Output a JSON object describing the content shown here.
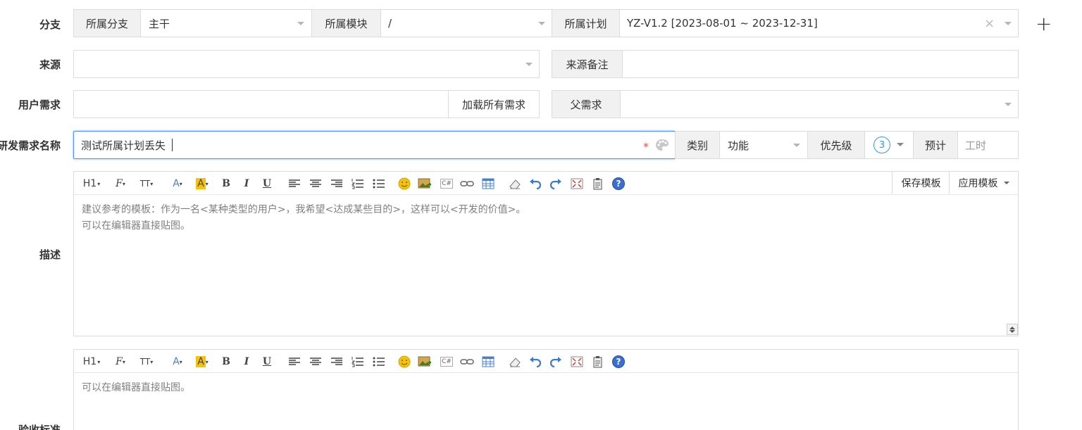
{
  "labels": {
    "branch": "分支",
    "source": "来源",
    "user_requirement": "用户需求",
    "name": "研发需求名称",
    "description": "描述",
    "acceptance": "验收标准"
  },
  "branch_row": {
    "branch_addon": "所属分支",
    "branch_value": "主干",
    "module_addon": "所属模块",
    "module_value": "/",
    "plan_addon": "所属计划",
    "plan_value": "YZ-V1.2 [2023-08-01 ~ 2023-12-31]",
    "clear_symbol": "×",
    "add_symbol": "+"
  },
  "source_row": {
    "source_value": "",
    "note_addon": "来源备注",
    "note_value": ""
  },
  "user_req_row": {
    "value": "",
    "load_all_button": "加载所有需求",
    "parent_addon": "父需求",
    "parent_value": ""
  },
  "name_row": {
    "value": "测试所属计划丢失",
    "required_mark": "*",
    "category_addon": "类别",
    "category_value": "功能",
    "priority_addon": "优先级",
    "priority_value": "3",
    "estimate_addon": "预计",
    "estimate_placeholder": "工时"
  },
  "editor_toolbar": {
    "h1": "H1",
    "font_family": "F",
    "font_size": "TT",
    "font_color": "A",
    "bg_color": "A",
    "bold": "B",
    "italic": "I",
    "underline": "U",
    "code": "C#",
    "help": "?"
  },
  "description_editor": {
    "save_template": "保存模板",
    "apply_template": "应用模板",
    "placeholder_line1": "建议参考的模板：作为一名<某种类型的用户>，我希望<达成某些目的>，这样可以<开发的价值>。",
    "placeholder_line2": "可以在编辑器直接贴图。"
  },
  "acceptance_editor": {
    "placeholder": "可以在编辑器直接贴图。"
  },
  "colors": {
    "focus_border": "#4d90fe",
    "required": "#e74c3c",
    "priority_blue": "#2f9bd6",
    "addon_bg": "#f1f1f1",
    "highlight_yellow": "#f4c20d"
  }
}
